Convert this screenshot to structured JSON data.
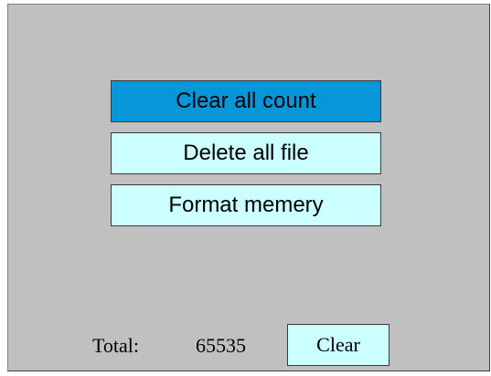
{
  "menu": {
    "items": [
      {
        "label": "Clear all count",
        "selected": true
      },
      {
        "label": "Delete all file",
        "selected": false
      },
      {
        "label": "Format memery",
        "selected": false
      }
    ]
  },
  "footer": {
    "total_label": "Total:",
    "total_value": "65535",
    "clear_label": "Clear"
  },
  "colors": {
    "panel_background": "#c0c0c0",
    "button_background": "#ccffff",
    "selected_background": "#0797d8"
  }
}
